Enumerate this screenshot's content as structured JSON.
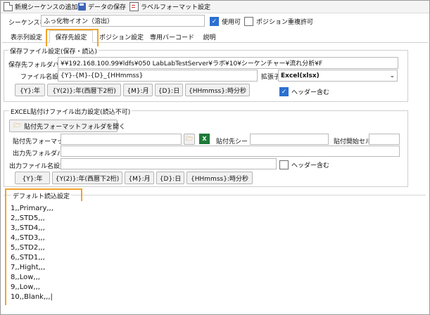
{
  "toolbar": {
    "new_sequence": "新規シーケンスの追加",
    "save_data": "データの保存",
    "label_format": "ラベルフォーマット設定"
  },
  "sequence": {
    "name_label": "シーケンス名",
    "name_value": "ふっ化物イオン（溶出）",
    "enabled_label": "使用可",
    "enabled_checked": true,
    "overlap_label": "ポジション重複許可",
    "overlap_checked": false
  },
  "tabs": [
    "表示列設定",
    "保存先設定",
    "ポジション設定",
    "専用バーコード",
    "説明"
  ],
  "save_group": {
    "title": "保存ファイル設定(保存・読込)",
    "folder_path_label": "保存先フォルダパス",
    "folder_path_value": "¥¥192.168.100.99¥ldfs¥050 LabLabTestServer¥ラボ¥10¥シーケンチャー¥流れ分析¥F",
    "file_name_label": "ファイル名設定",
    "file_name_value": "{Y}-{M}-{D}_{HHmmss}",
    "extension_label": "拡張子",
    "extension_value": "Excel(xlsx)",
    "header_label": "ヘッダー含む",
    "header_checked": true,
    "buttons": [
      "{Y}:年",
      "{Y(2)}:年(西暦下2桁)",
      "{M}:月",
      "{D}:日",
      "{HHmmss}:時分秒"
    ]
  },
  "excel_group": {
    "title": "EXCEL貼付けファイル出力設定(読込不可)",
    "open_folder_button": "貼付先フォーマットフォルダを開く",
    "paste_format_label": "貼付先フォーマット",
    "paste_sheet_label": "貼付先シート",
    "paste_start_cell_label": "貼付開始セル",
    "output_folder_label": "出力先フォルダパス",
    "output_file_label": "出力ファイル名設定",
    "header_label": "ヘッダー含む",
    "header_checked": false,
    "buttons": [
      "{Y}:年",
      "{Y(2)}:年(西暦下2桁)",
      "{M}:月",
      "{D}:日",
      "{HHmmss}:時分秒"
    ]
  },
  "default_read": {
    "title": "デフォルト読込設定",
    "lines": [
      "1,,Primary,,,",
      "2,,STD5,,,",
      "3,,STD4,,,",
      "4,,STD3,,,",
      "5,,STD2,,,",
      "6,,STD1,,,",
      "7,,Hight,,,",
      "8,,Low,,,",
      "9,,Low,,,",
      "10,,Blank,,,|"
    ]
  },
  "colors": {
    "highlight": "#f0a42c",
    "checkbox_on": "#2b6fd1",
    "excel_green": "#1f7a3a"
  }
}
